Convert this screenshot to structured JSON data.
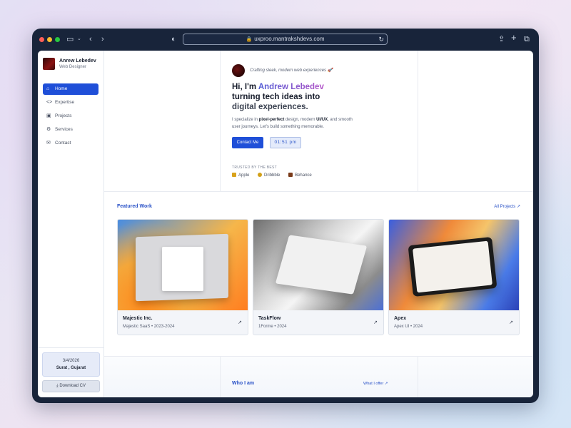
{
  "browser": {
    "url": "uxproo.mantrakshdevs.com"
  },
  "sidebar": {
    "name": "Anrew Lebedev",
    "role": "Web Designer",
    "items": [
      {
        "label": "Home",
        "icon": "home-icon",
        "active": true
      },
      {
        "label": "Expertise",
        "icon": "code-icon"
      },
      {
        "label": "Projects",
        "icon": "briefcase-icon"
      },
      {
        "label": "Services",
        "icon": "services-icon"
      },
      {
        "label": "Contact",
        "icon": "mail-icon"
      }
    ],
    "date": "3/4/2026",
    "location": "Surat , Gujarat",
    "download_cv": "Download CV"
  },
  "hero": {
    "tagline": "Crafting sleek, modern web experiences 🚀",
    "greeting": "Hi, I'm ",
    "name": "Andrew Lebedev",
    "line2": "turning tech ideas into",
    "line3": "digital experiences.",
    "desc_1": "I specialize in ",
    "desc_b1": "pixel-perfect",
    "desc_2": " design, modern ",
    "desc_b2": "UI/UX",
    "desc_3": ", and smooth user journeys. Let's build something memorable.",
    "contact": "Contact Me",
    "time": "01:51 pm",
    "trusted": "TRUSTED BY THE BEST",
    "brands": [
      {
        "label": "Apple",
        "color": "#d9a21b"
      },
      {
        "label": "Dribbble",
        "color": "#d2a018"
      },
      {
        "label": "Behance",
        "color": "#7a3b1a"
      }
    ]
  },
  "featured": {
    "title": "Featured Work",
    "all": "All Projects ↗",
    "cards": [
      {
        "title": "Majestic Inc.",
        "sub": "Majestic SaaS • 2023-2024"
      },
      {
        "title": "TaskFlow",
        "sub": "1Forme • 2024"
      },
      {
        "title": "Apex",
        "sub": "Apex UI • 2024"
      }
    ]
  },
  "who": {
    "title": "Who I am",
    "link": "What I offer ↗"
  },
  "colors": {
    "accent": "#1f4fd8",
    "frame": "#18243a"
  }
}
